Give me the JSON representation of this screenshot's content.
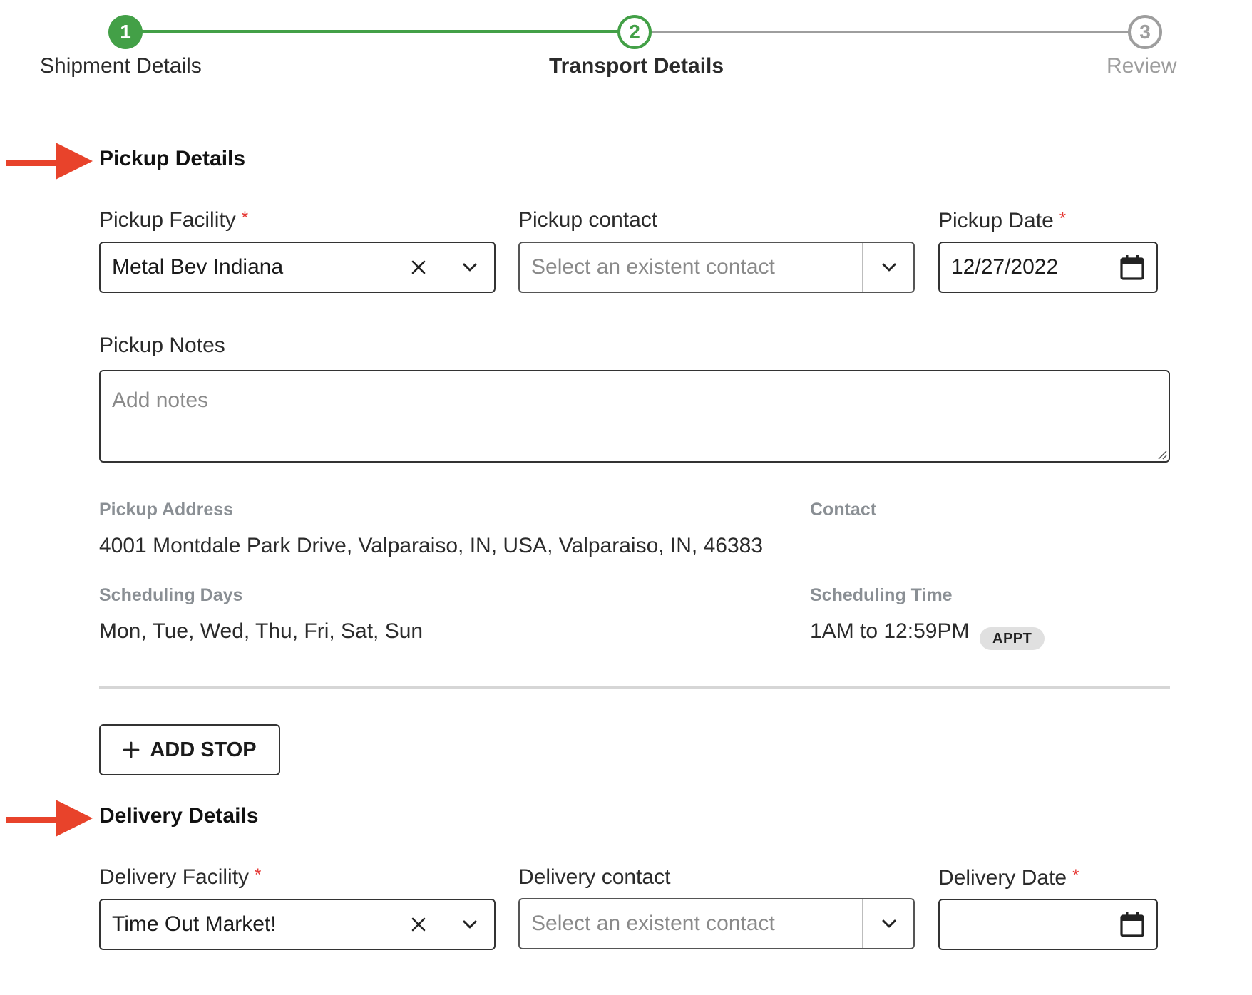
{
  "stepper": {
    "steps": [
      {
        "number": "1",
        "label": "Shipment Details",
        "state": "complete"
      },
      {
        "number": "2",
        "label": "Transport Details",
        "state": "active"
      },
      {
        "number": "3",
        "label": "Review",
        "state": "pending"
      }
    ],
    "colors": {
      "complete": "#43a047",
      "pending": "#9e9e9e"
    }
  },
  "pickup": {
    "title": "Pickup Details",
    "facility": {
      "label": "Pickup Facility",
      "required_mark": "*",
      "value": "Metal Bev Indiana"
    },
    "contact": {
      "label": "Pickup contact",
      "placeholder": "Select an existent contact"
    },
    "date": {
      "label": "Pickup Date",
      "required_mark": "*",
      "value": "12/27/2022"
    },
    "notes": {
      "label": "Pickup Notes",
      "placeholder": "Add notes"
    },
    "address": {
      "label": "Pickup Address",
      "value": "4001 Montdale Park Drive, Valparaiso, IN, USA, Valparaiso, IN, 46383"
    },
    "info_contact": {
      "label": "Contact"
    },
    "scheduling_days": {
      "label": "Scheduling Days",
      "value": "Mon, Tue, Wed, Thu, Fri, Sat, Sun"
    },
    "scheduling_time": {
      "label": "Scheduling Time",
      "value": "1AM to 12:59PM",
      "badge": "APPT"
    }
  },
  "add_stop": {
    "label": "ADD STOP"
  },
  "delivery": {
    "title": "Delivery Details",
    "facility": {
      "label": "Delivery Facility",
      "required_mark": "*",
      "value": "Time Out Market!"
    },
    "contact": {
      "label": "Delivery contact",
      "placeholder": "Select an existent contact"
    },
    "date": {
      "label": "Delivery Date",
      "required_mark": "*",
      "value": ""
    }
  },
  "colors": {
    "accent": "#43a047",
    "required": "#e53935",
    "annotation_arrow": "#e8432b"
  }
}
